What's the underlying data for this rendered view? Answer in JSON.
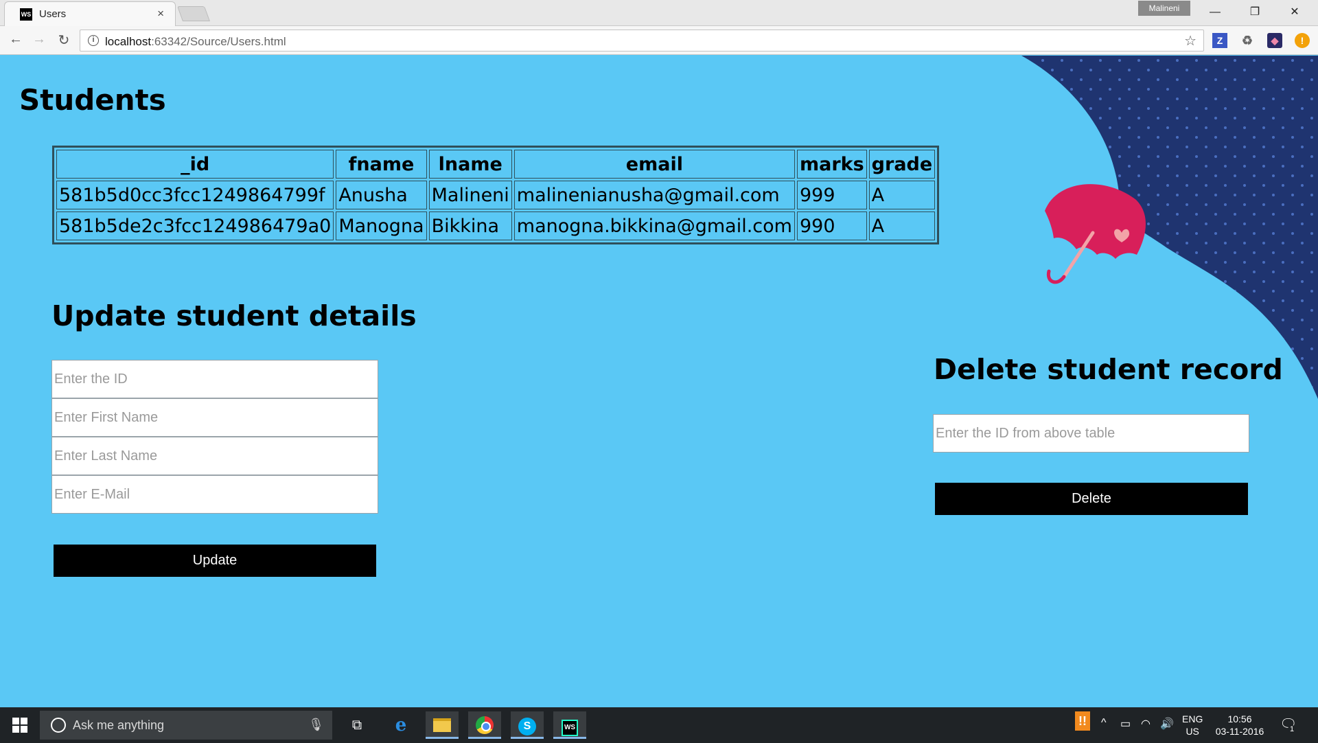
{
  "browser": {
    "tab_title": "Users",
    "tab_favicon": "WS",
    "tab_close": "×",
    "profile_name": "Malineni",
    "window_controls": {
      "minimize": "—",
      "maximize": "❐",
      "close": "✕"
    },
    "nav": {
      "back": "←",
      "forward": "→",
      "reload": "↻"
    },
    "url": {
      "host": "localhost",
      "rest": ":63342/Source/Users.html"
    },
    "info_icon": "i",
    "bookmark_star": "☆",
    "extensions": [
      "Z",
      "♻",
      "◆",
      "!"
    ]
  },
  "page": {
    "students_heading": "Students",
    "table": {
      "headers": [
        "_id",
        "fname",
        "lname",
        "email",
        "marks",
        "grade"
      ],
      "rows": [
        [
          "581b5d0cc3fcc1249864799f",
          "Anusha",
          "Malineni",
          "malinenianusha@gmail.com",
          "999",
          "A"
        ],
        [
          "581b5de2c3fcc124986479a0",
          "Manogna",
          "Bikkina",
          "manogna.bikkina@gmail.com",
          "990",
          "A"
        ]
      ]
    },
    "update": {
      "heading": "Update student details",
      "id_placeholder": "Enter the ID",
      "fname_placeholder": "Enter First Name",
      "lname_placeholder": "Enter Last Name",
      "email_placeholder": "Enter E-Mail",
      "button_label": "Update"
    },
    "delete": {
      "heading": "Delete student record",
      "id_placeholder": "Enter the ID from above table",
      "button_label": "Delete"
    },
    "colors": {
      "background": "#5ac8f5",
      "dark_curve": "#1f3470",
      "umbrella": "#d81f5a"
    }
  },
  "taskbar": {
    "search_hint": "Ask me anything",
    "mic_icon": "🎙",
    "task_view_icon": "⧉",
    "edge_icon": "e",
    "skype_icon": "S",
    "ws_icon": "WS",
    "tray": {
      "warning": "!!",
      "up_arrow": "^",
      "battery": "▭",
      "wifi": "◠",
      "volume": "🔊",
      "lang_top": "ENG",
      "lang_bottom": "US",
      "time": "10:56",
      "date": "03-11-2016",
      "notify_icon": "🗨",
      "notify_count": "1"
    }
  }
}
